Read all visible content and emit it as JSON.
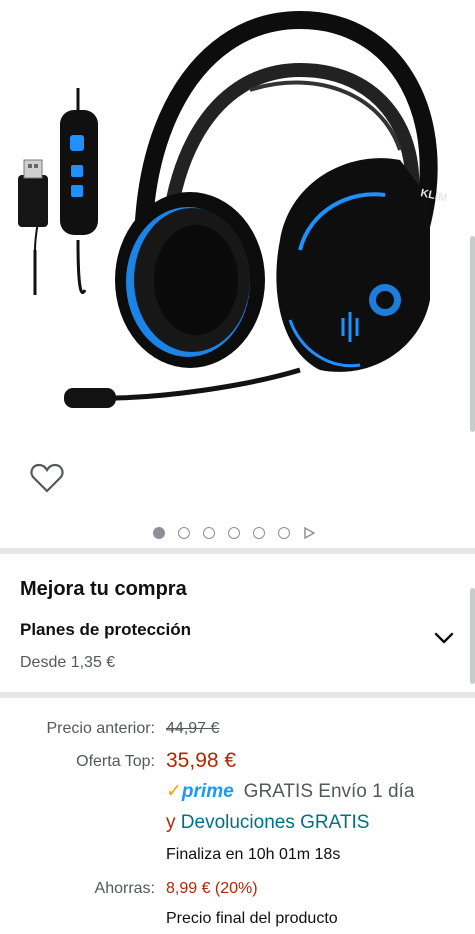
{
  "product": {
    "image_alt": "KLIM gaming headset with USB controller",
    "brand_mark": "KLIM"
  },
  "carousel": {
    "dot_count": 6,
    "active_index": 0
  },
  "upgrade": {
    "title": "Mejora tu compra",
    "protection_title": "Planes de protección",
    "protection_price": "Desde 1,35 €"
  },
  "pricing": {
    "previous_label": "Precio anterior:",
    "previous_value": "44,97 €",
    "offer_label": "Oferta Top:",
    "offer_value": "35,98 €",
    "prime_check": "✓",
    "prime_word": "prime",
    "free_shipping": "GRATIS Envío 1 día",
    "returns_prefix": "y",
    "returns_link": "Devoluciones GRATIS",
    "deal_ends": "Finaliza en 10h 01m 18s",
    "save_label": "Ahorras:",
    "save_value": "8,99 € (20%)",
    "final_price_note": "Precio final del producto"
  },
  "colors": {
    "price_red": "#b12704",
    "link_teal": "#007185",
    "prime_blue": "#1a98ff",
    "prime_orange": "#f7a700",
    "headset_blue": "#1e90ff"
  }
}
